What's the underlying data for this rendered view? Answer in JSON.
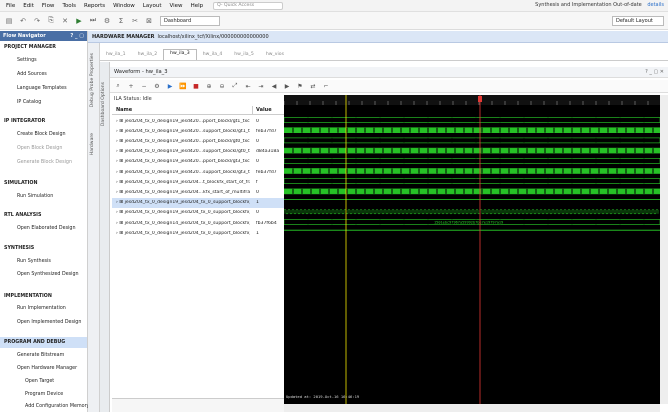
{
  "menu": [
    "File",
    "Edit",
    "Flow",
    "Tools",
    "Reports",
    "Window",
    "Layout",
    "View",
    "Help"
  ],
  "quick_access": "Q- Quick Access",
  "status": {
    "text": "Synthesis and Implementation Out-of-date",
    "link": "details"
  },
  "toolbar": {
    "dashboard": "Dashboard",
    "layout": "Default Layout"
  },
  "flow_navigator": {
    "title": "Flow Navigator",
    "sections": [
      {
        "label": "PROJECT MANAGER",
        "items": [
          "Settings",
          "Add Sources",
          "Language Templates",
          "IP Catalog"
        ]
      },
      {
        "label": "IP INTEGRATOR",
        "items": [
          "Create Block Design",
          "Open Block Design",
          "Generate Block Design"
        ]
      },
      {
        "label": "SIMULATION",
        "items": [
          "Run Simulation"
        ]
      },
      {
        "label": "RTL ANALYSIS",
        "items": [
          "Open Elaborated Design"
        ]
      },
      {
        "label": "SYNTHESIS",
        "items": [
          "Run Synthesis",
          "Open Synthesized Design"
        ]
      },
      {
        "label": "IMPLEMENTATION",
        "items": [
          "Run Implementation",
          "Open Implemented Design"
        ]
      },
      {
        "label": "PROGRAM AND DEBUG",
        "items": [
          "Generate Bitstream",
          "Open Hardware Manager",
          "Open Target",
          "Program Device",
          "Add Configuration Memory Devic"
        ]
      }
    ]
  },
  "hardware_manager": {
    "title": "HARDWARE MANAGER",
    "target": "localhost/xilinx_tcf/Xilinx/000000000000000"
  },
  "side_tabs": [
    "Debug Probe Properties",
    "Dashboard Options",
    "Hardware"
  ],
  "tabs": [
    "hw_ila_1",
    "hw_ila_2",
    "hw_ila_3",
    "hw_ila_4",
    "hw_ila_5",
    "hw_vios"
  ],
  "active_tab_index": 2,
  "waveform": {
    "title": "Waveform - hw_ila_3",
    "ila_status": "ILA Status: Idle",
    "col_name": "Name",
    "col_value": "Value",
    "signals": [
      {
        "name": "jesd204_tx_0_design19_jesd420...pport_blockl/gt1_txcharis[3:0]",
        "value": "0"
      },
      {
        "name": "jesd204_tx_0_design19_jesd420...support_blockl/gt1_txdata[31:0]",
        "value": "feb37fd7"
      },
      {
        "name": "jesd204_tx_0_design19_jesd420...pport_blockl/gt0_txcharis[3:0]",
        "value": "0"
      },
      {
        "name": "jesd204_tx_0_design19_jesd420...support_blockl/gt0_txdata[31:0]",
        "value": "d84a318a"
      },
      {
        "name": "jesd204_tx_0_design19_jesd420...pport_blockl/gt3_txcharis[3:0]",
        "value": "0"
      },
      {
        "name": "jesd204_tx_0_design19_jesd420...support_blockl/gt3_txdata[31:0]",
        "value": "feb37fd7"
      },
      {
        "name": "jesd204_tx_0_design19_jesd204...t_blockfx_start_of_frame[3:0]",
        "value": "f"
      },
      {
        "name": "jesd204_tx_0_design19_jesd204...kfx_start_of_multiframe[3:0]",
        "value": "0"
      },
      {
        "name": "jesd204_tx_0_design19_jesd204_tx_0_support_blockfx_sync",
        "value": "1"
      },
      {
        "name": "jesd204_tx_0_design19_jesd204_tx_0_support_blockfx_sysref",
        "value": "0"
      },
      {
        "name": "jesd204_tx_0_design14_jesd204_tx_0_support_blockfx_tdata[127:0]",
        "value": "fb37f6b4"
      },
      {
        "name": "jesd204_tx_0_design19_jesd204_tx_0_support_blockfx_tready",
        "value": "1"
      }
    ],
    "selected_signal_index": 8,
    "bus_annotation": "1501ebc97967a59992b7be7e19797a19",
    "timestamp": "Updated at: 2019-Oct-16 16:46:19"
  },
  "colors": {
    "wave_bg": "#000000",
    "wave_green": "#2bd82b",
    "marker_red": "#e53935",
    "cursor_yellow": "#f2e600",
    "selection": "#cfe0f7"
  }
}
